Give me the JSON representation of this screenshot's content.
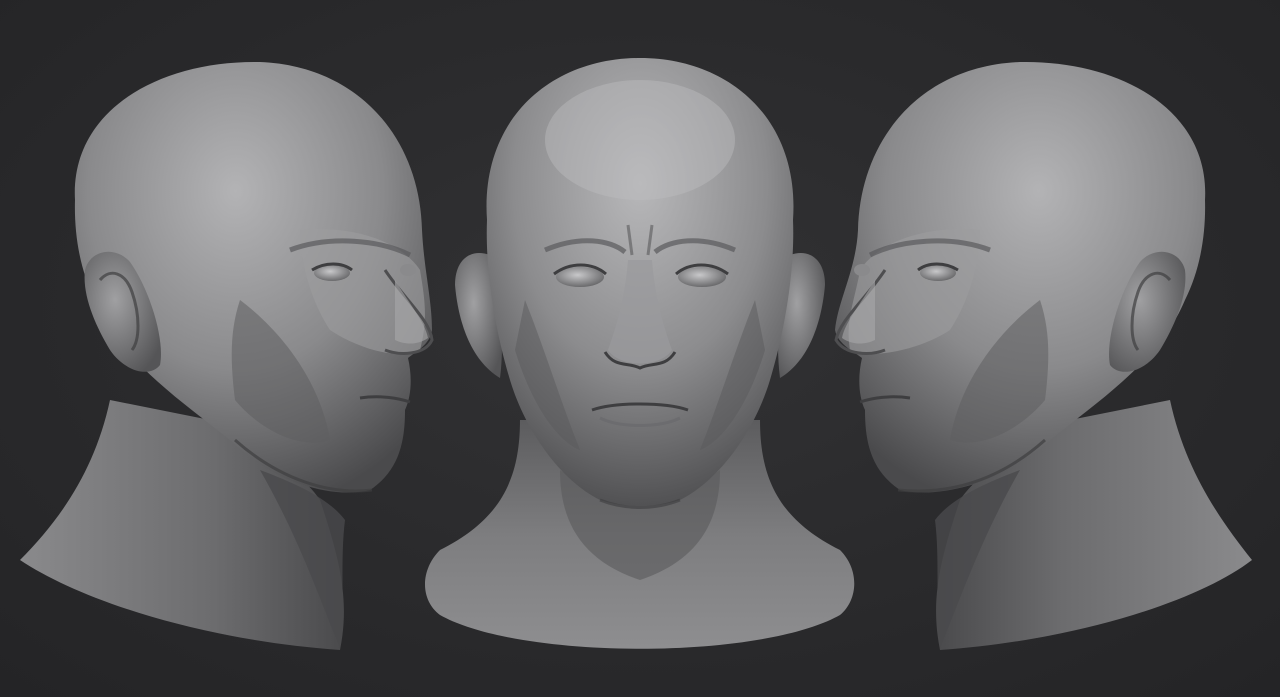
{
  "scene": {
    "views": [
      {
        "id": "three-quarter-left",
        "facing": "right"
      },
      {
        "id": "front",
        "facing": "viewer"
      },
      {
        "id": "three-quarter-right",
        "facing": "left"
      }
    ],
    "colors": {
      "background": "#2b2b2d",
      "clay_mid": "#7f7f81",
      "clay_light": "#b4b4b6",
      "clay_dark": "#3a3a3c"
    }
  }
}
